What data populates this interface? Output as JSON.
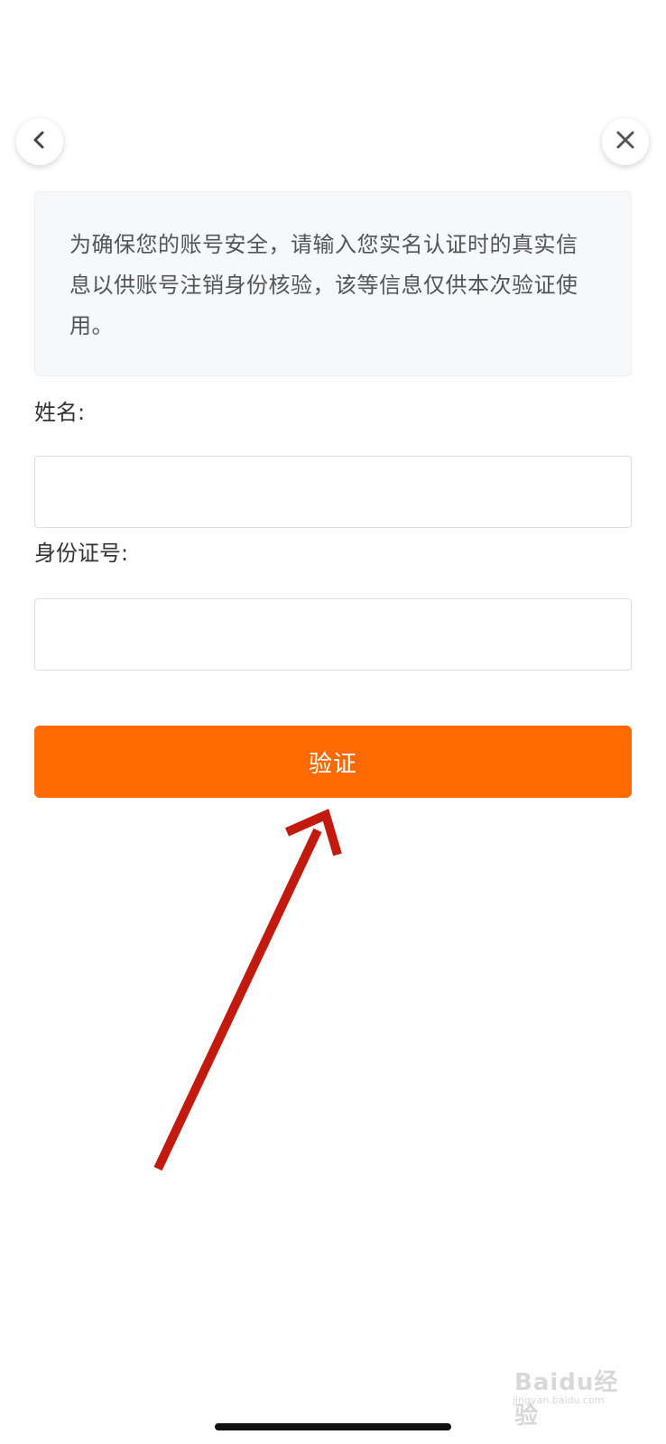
{
  "nav": {
    "back_icon": "chevron-left-icon",
    "close_icon": "close-icon"
  },
  "notice": {
    "text": "为确保您的账号安全，请输入您实名认证时的真实信息以供账号注销身份核验，该等信息仅供本次验证使用。"
  },
  "form": {
    "name_label": "姓名:",
    "name_value": "",
    "id_label": "身份证号:",
    "id_value": ""
  },
  "actions": {
    "verify_label": "验证"
  },
  "annotation": {
    "arrow_color": "#c21a0e"
  },
  "watermark": {
    "brand": "Baidu经验",
    "site": "jingyan.baidu.com"
  },
  "colors": {
    "accent": "#ff6a00",
    "notice_bg": "#f7f8fa"
  }
}
